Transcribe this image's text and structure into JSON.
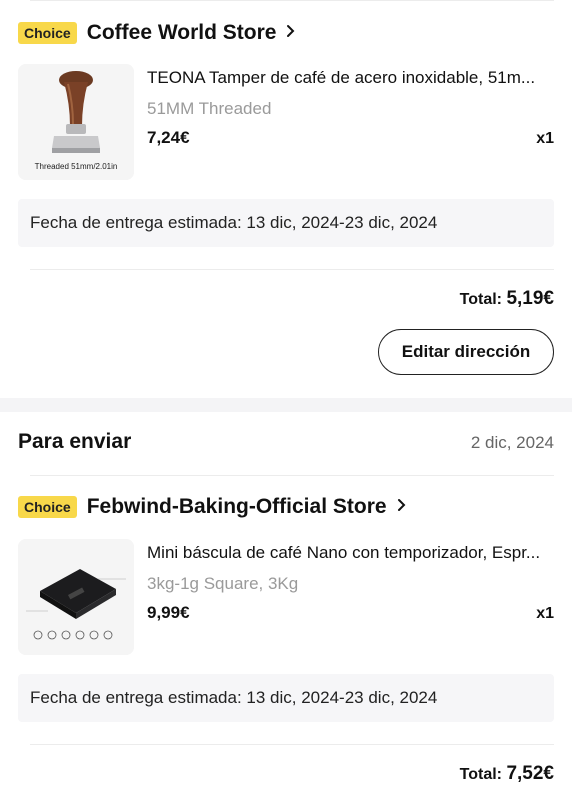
{
  "store1": {
    "badge": "Choice",
    "name": "Coffee World Store",
    "product": {
      "title": "TEONA Tamper de café de acero inoxidable, 51m...",
      "variant": "51MM Threaded",
      "price": "7,24€",
      "qty": "x1",
      "image_caption": "Threaded 51mm/2.01in"
    },
    "delivery": "Fecha de entrega estimada: 13 dic, 2024-23 dic, 2024",
    "total_label": "Total:",
    "total_value": "5,19€",
    "edit_button": "Editar dirección"
  },
  "section2": {
    "title": "Para enviar",
    "date": "2 dic, 2024"
  },
  "store2": {
    "badge": "Choice",
    "name": "Febwind-Baking-Official Store",
    "product": {
      "title": "Mini báscula de café Nano con temporizador, Espr...",
      "variant": "3kg-1g Square, 3Kg",
      "price": "9,99€",
      "qty": "x1"
    },
    "delivery": "Fecha de entrega estimada: 13 dic, 2024-23 dic, 2024",
    "total_label": "Total:",
    "total_value": "7,52€"
  },
  "colors": {
    "choice_badge": "#f8d84a",
    "separator": "#f4f4f6",
    "delivery_bg": "#f6f6f8"
  }
}
